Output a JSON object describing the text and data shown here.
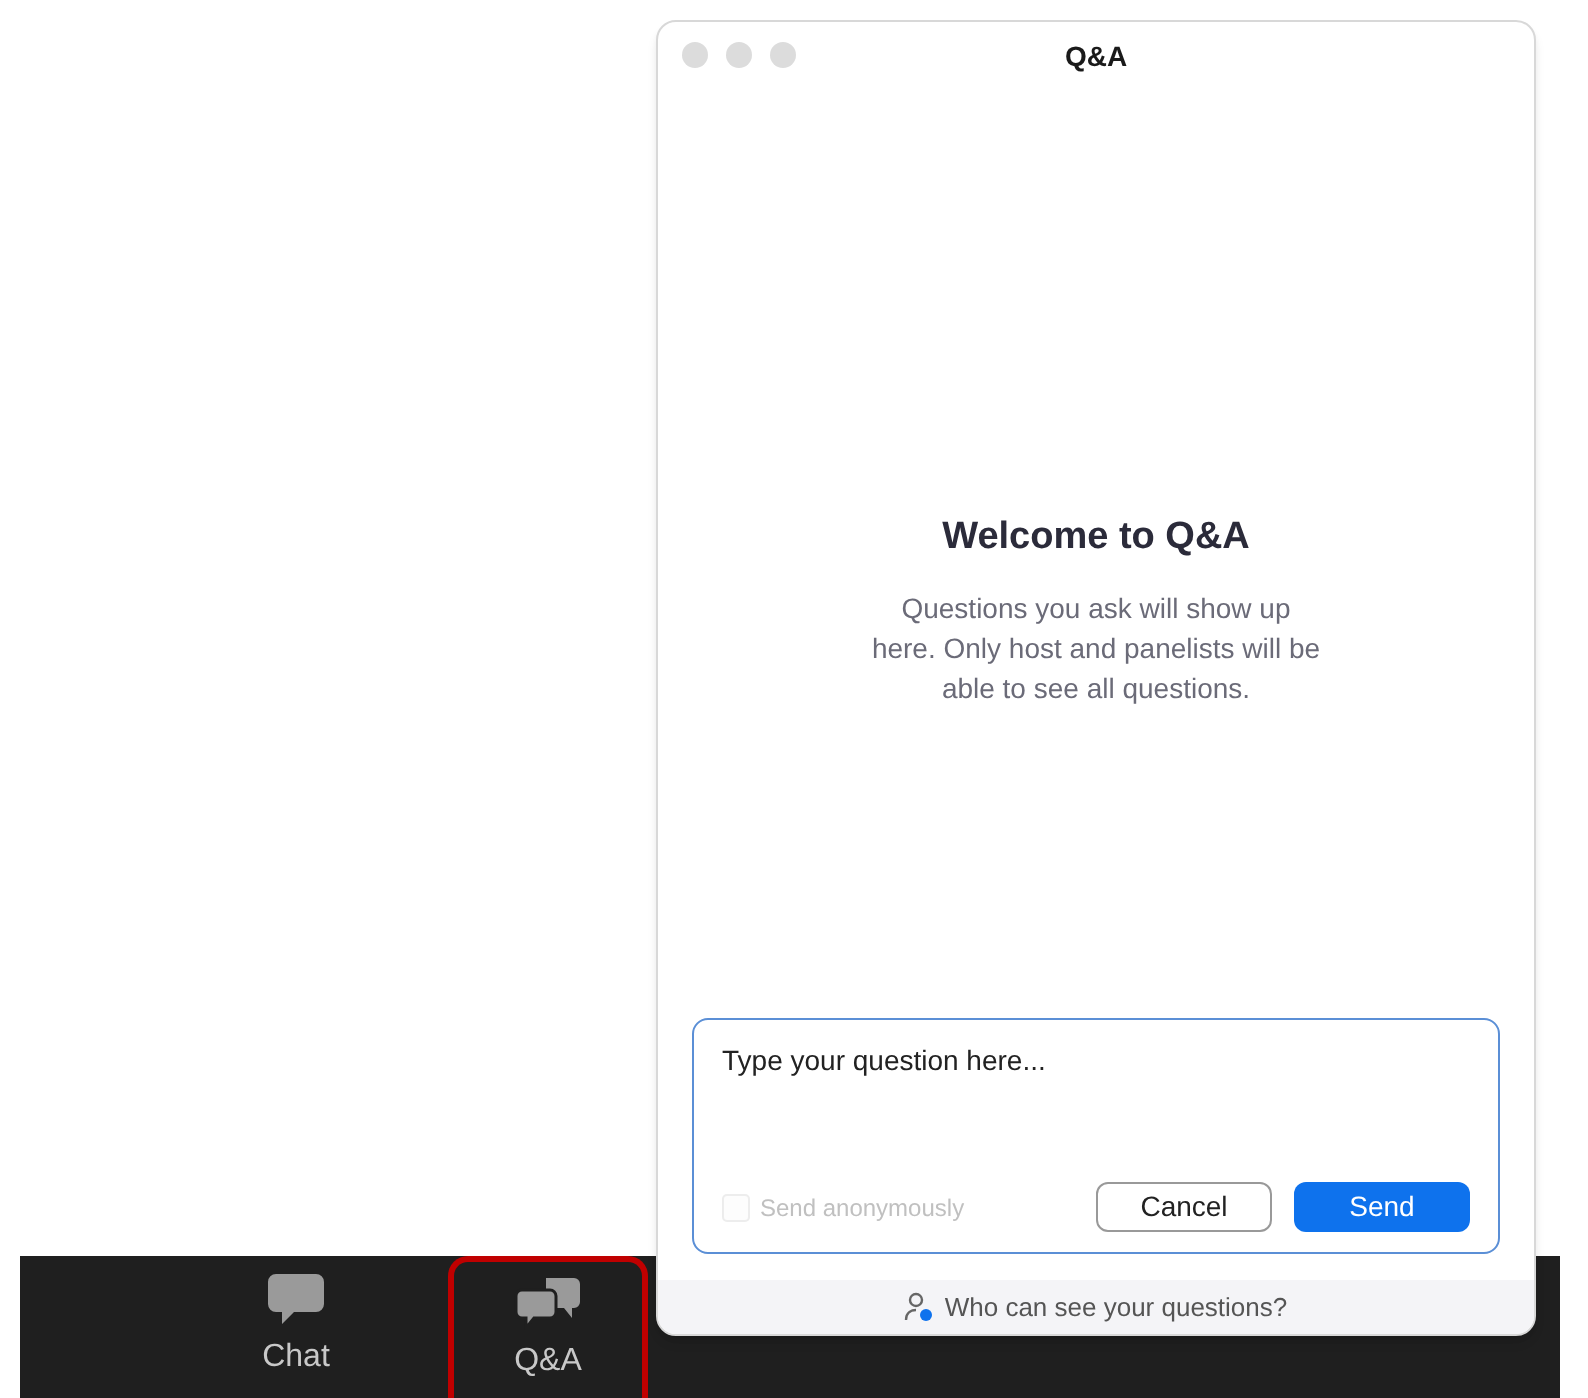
{
  "toolbar": {
    "items": [
      {
        "label": "Chat",
        "kind": "chat",
        "highlighted": false
      },
      {
        "label": "Q&A",
        "kind": "qa",
        "highlighted": true
      }
    ]
  },
  "window": {
    "title": "Q&A"
  },
  "welcome": {
    "heading": "Welcome to Q&A",
    "text": "Questions you ask will show up here. Only host and panelists will be able to see all questions."
  },
  "question": {
    "placeholder": "Type your question here...",
    "anonymous": {
      "label": "Send anonymously",
      "checked": false,
      "disabled": true
    },
    "buttons": [
      {
        "label": "Cancel",
        "kind": "secondary"
      },
      {
        "label": "Send",
        "kind": "primary"
      }
    ]
  },
  "footer": {
    "link": "Who can see your questions?"
  }
}
